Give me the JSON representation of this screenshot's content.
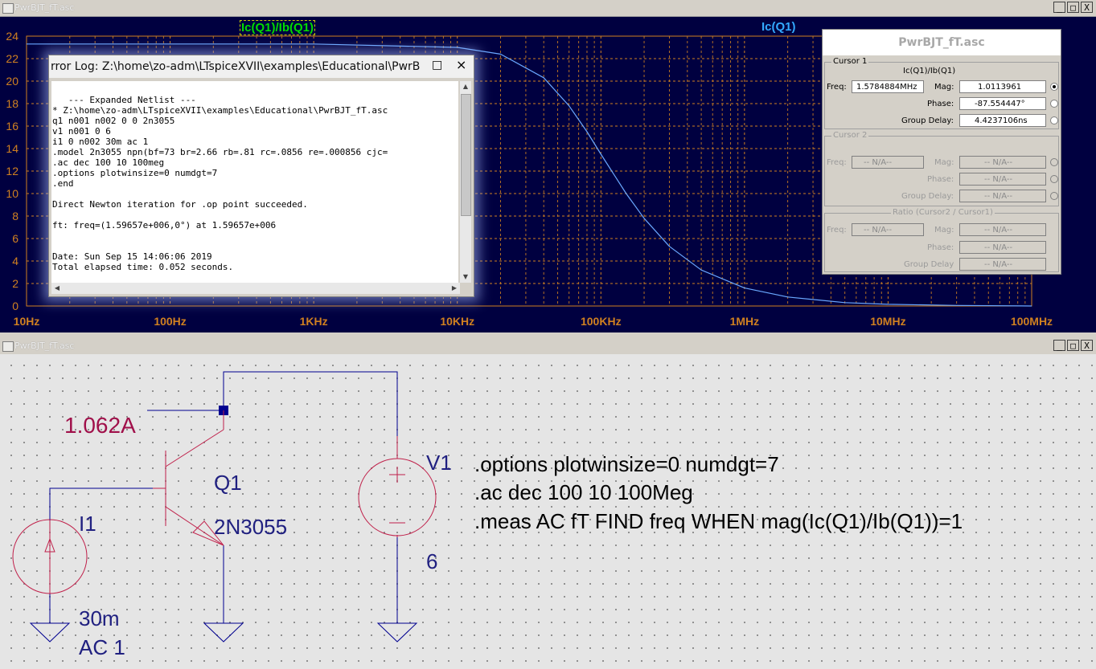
{
  "plot_window": {
    "title": "PwrBJT_fT.asc",
    "min_glyph": "_",
    "max_glyph": "□",
    "close_glyph": "X",
    "trace_labels": [
      "Ic(Q1)/Ib(Q1)",
      "Ic(Q1)"
    ]
  },
  "chart_data": {
    "type": "line",
    "title": "",
    "xscale": "log",
    "xlim": [
      10,
      100000000
    ],
    "ylim": [
      0,
      24
    ],
    "grid": true,
    "x_tick_labels": [
      "10Hz",
      "100Hz",
      "1KHz",
      "10KHz",
      "100KHz",
      "1MHz",
      "10MHz",
      "100MHz"
    ],
    "y_tick_labels": [
      "0",
      "2",
      "4",
      "6",
      "8",
      "10",
      "12",
      "14",
      "16",
      "18",
      "20",
      "22",
      "24"
    ],
    "colors": {
      "background": "#000040",
      "grid": "#d08020",
      "axis_text": "#d08020",
      "trace": "#6aa8ff",
      "trace_label_1": "#00dd00",
      "trace_label_2": "#33aaff"
    },
    "series": [
      {
        "name": "Ic(Q1)",
        "x": [
          10,
          100,
          1000,
          10000,
          20000,
          40000,
          60000,
          80000,
          100000,
          150000,
          200000,
          300000,
          500000,
          1000000,
          2000000,
          5000000,
          10000000,
          30000000,
          100000000
        ],
        "values": [
          23.3,
          23.3,
          23.3,
          23.0,
          22.4,
          20.3,
          17.8,
          15.5,
          13.5,
          10.0,
          7.8,
          5.3,
          3.2,
          1.6,
          0.8,
          0.3,
          0.15,
          0.05,
          0.0
        ]
      }
    ]
  },
  "error_log": {
    "title": "rror Log: Z:\\home\\zo-adm\\LTspiceXVII\\examples\\Educational\\PwrB",
    "min_glyph": "□",
    "close_glyph": "×",
    "text": "\n   --- Expanded Netlist ---\n* Z:\\home\\zo-adm\\LTspiceXVII\\examples\\Educational\\PwrBJT_fT.asc\nq1 n001 n002 0 0 2n3055\nv1 n001 0 6\ni1 0 n002 30m ac 1\n.model 2n3055 npn(bf=73 br=2.66 rb=.81 rc=.0856 re=.000856 cjc=\n.ac dec 100 10 100meg\n.options plotwinsize=0 numdgt=7\n.end\n\nDirect Newton iteration for .op point succeeded.\n\nft: freq=(1.59657e+006,0°) at 1.59657e+006\n\n\nDate: Sun Sep 15 14:06:06 2019\nTotal elapsed time: 0.052 seconds.",
    "scroll_up": "▲",
    "scroll_down": "▼",
    "scroll_left": "◀",
    "scroll_right": "▶"
  },
  "cursor_panel": {
    "title": "PwrBJT_fT.asc",
    "cursor1": {
      "label": "Cursor 1",
      "trace": "Ic(Q1)/Ib(Q1)",
      "freq_label": "Freq:",
      "freq": "1.5784884MHz",
      "mag_label": "Mag:",
      "mag": "1.0113961",
      "phase_label": "Phase:",
      "phase": "-87.554447°",
      "gd_label": "Group Delay:",
      "gd": "4.4237106ns"
    },
    "cursor2": {
      "label": "Cursor 2",
      "freq_label": "Freq:",
      "freq": "-- N/A--",
      "mag_label": "Mag:",
      "mag": "-- N/A--",
      "phase_label": "Phase:",
      "phase": "-- N/A--",
      "gd_label": "Group Delay:",
      "gd": "-- N/A--"
    },
    "ratio": {
      "label": "Ratio (Cursor2 / Cursor1)",
      "freq_label": "Freq:",
      "freq": "-- N/A--",
      "mag_label": "Mag:",
      "mag": "-- N/A--",
      "phase_label": "Phase:",
      "phase": "-- N/A--",
      "gd_label": "Group Delay",
      "gd": "-- N/A--"
    }
  },
  "schematic_window": {
    "title": "PwrBJT_fT.asc",
    "min_glyph": "_",
    "max_glyph": "□",
    "close_glyph": "X",
    "probe_value": "1.062A",
    "q1_name": "Q1",
    "q1_model": "2N3055",
    "i1_name": "I1",
    "i1_value": "30m",
    "i1_ac": "AC 1",
    "v1_name": "V1",
    "v1_value": "6",
    "directives": [
      ".options plotwinsize=0 numdgt=7",
      ".ac dec 100 10 100Meg",
      ".meas AC fT FIND freq WHEN mag(Ic(Q1)/Ib(Q1))=1"
    ],
    "colors": {
      "wire": "#000090",
      "component": "#c0204a",
      "label": "#202080",
      "probe": "#a0104a"
    }
  }
}
